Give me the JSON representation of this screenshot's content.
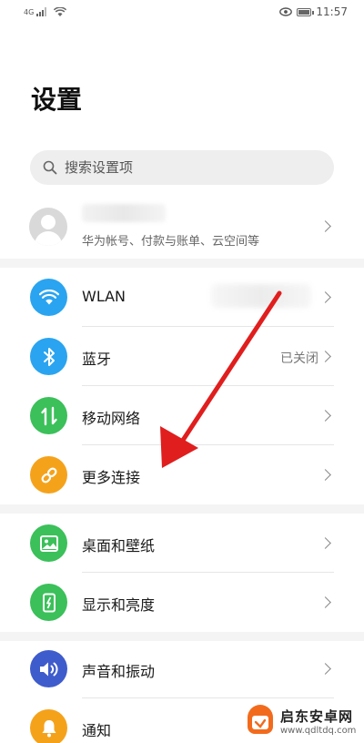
{
  "status_bar": {
    "signal_text": "4G",
    "time": "11:57"
  },
  "header": {
    "title": "设置"
  },
  "search": {
    "placeholder": "搜索设置项"
  },
  "account": {
    "subtitle": "华为帐号、付款与账单、云空间等"
  },
  "settings_groups": [
    {
      "items": [
        {
          "label": "WLAN",
          "value": "",
          "icon": "wifi-icon",
          "color": "#2aa4f0"
        },
        {
          "label": "蓝牙",
          "value": "已关闭",
          "icon": "bluetooth-icon",
          "color": "#2aa4f0"
        },
        {
          "label": "移动网络",
          "value": "",
          "icon": "mobile-data-icon",
          "color": "#3bc05a"
        },
        {
          "label": "更多连接",
          "value": "",
          "icon": "link-icon",
          "color": "#f5a21b"
        }
      ]
    },
    {
      "items": [
        {
          "label": "桌面和壁纸",
          "value": "",
          "icon": "image-icon",
          "color": "#3bc05a"
        },
        {
          "label": "显示和亮度",
          "value": "",
          "icon": "display-icon",
          "color": "#3bc05a"
        }
      ]
    },
    {
      "items": [
        {
          "label": "声音和振动",
          "value": "",
          "icon": "volume-icon",
          "color": "#3f5ccc"
        },
        {
          "label": "通知",
          "value": "",
          "icon": "bell-icon",
          "color": "#f5a21b"
        }
      ]
    }
  ],
  "annotation": {
    "arrow_color": "#e01e1e"
  },
  "watermark": {
    "name": "启东安卓网",
    "url": "www.qdltdq.com"
  }
}
